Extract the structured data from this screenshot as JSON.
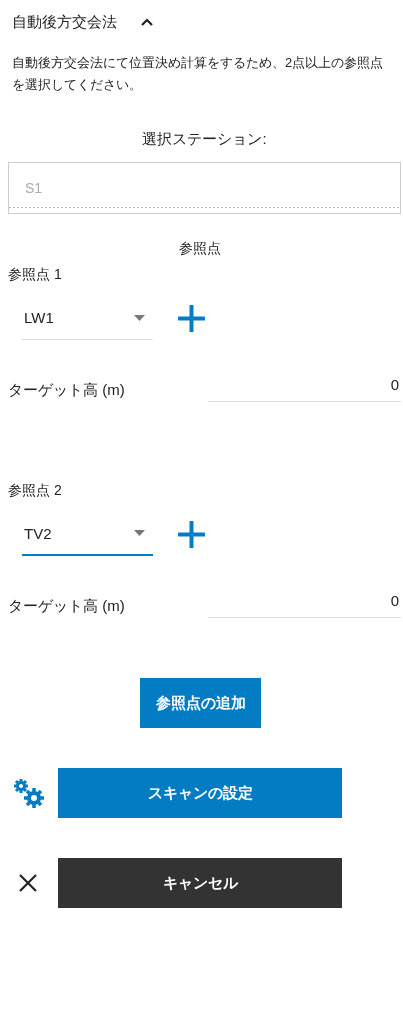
{
  "section": {
    "title": "自動後方交会法",
    "expanded": true,
    "description": "自動後方交会法にて位置決め計算をするため、2点以上の参照点を選択してください。"
  },
  "station": {
    "label": "選択ステーション:",
    "value": "S1",
    "disabled": true
  },
  "reference_points": {
    "heading": "参照点",
    "items": [
      {
        "label": "参照点 1",
        "value": "LW1",
        "focused": false,
        "target_label": "ターゲット高 (m)",
        "target_value": "0"
      },
      {
        "label": "参照点 2",
        "value": "TV2",
        "focused": true,
        "target_label": "ターゲット高 (m)",
        "target_value": "0"
      }
    ]
  },
  "add_button": "参照点の追加",
  "scan_button": "スキャンの設定",
  "cancel_button": "キャンセル"
}
